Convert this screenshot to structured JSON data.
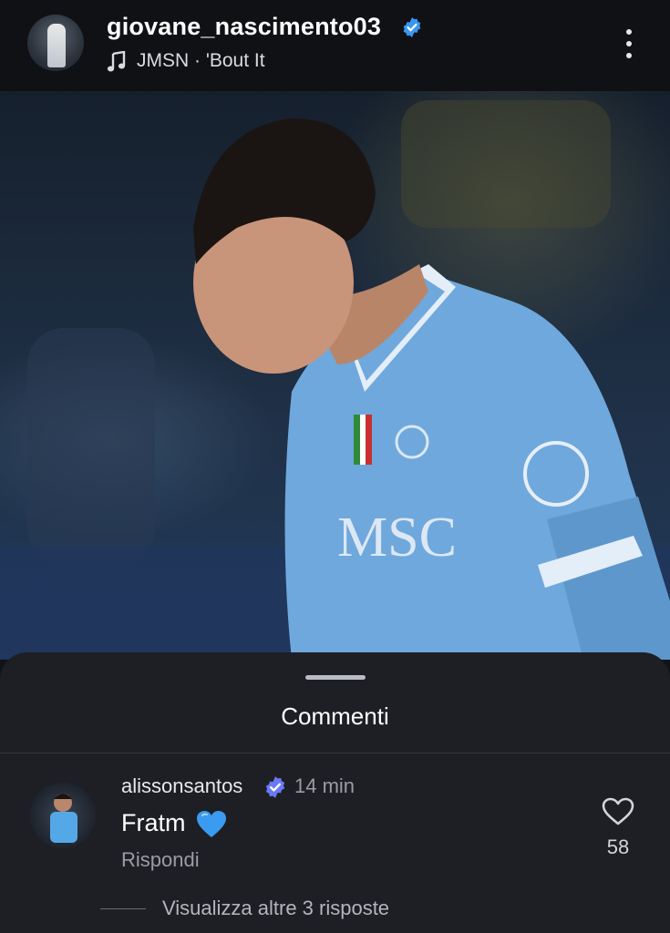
{
  "header": {
    "username": "giovane_nascimento03",
    "song": "JMSN · 'Bout It",
    "icons": [
      "profile-avatar",
      "verified-badge-icon",
      "music-note-icon",
      "more-vertical-icon"
    ]
  },
  "post": {
    "jersey_text": "MSC"
  },
  "comments_sheet": {
    "title": "Commenti",
    "comment": {
      "username": "alissonsantos",
      "time": "14 min",
      "text": "Fratm",
      "emoji": "blue-heart-emoji",
      "reply_label": "Rispondi",
      "like_count": "58",
      "view_replies": "Visualizza altre 3 risposte"
    }
  },
  "colors": {
    "background": "#111318",
    "sheet": "#1d1f24",
    "verified": "#3897f0",
    "jersey": "#6fa8dc",
    "muted_text": "#9a9da4"
  }
}
